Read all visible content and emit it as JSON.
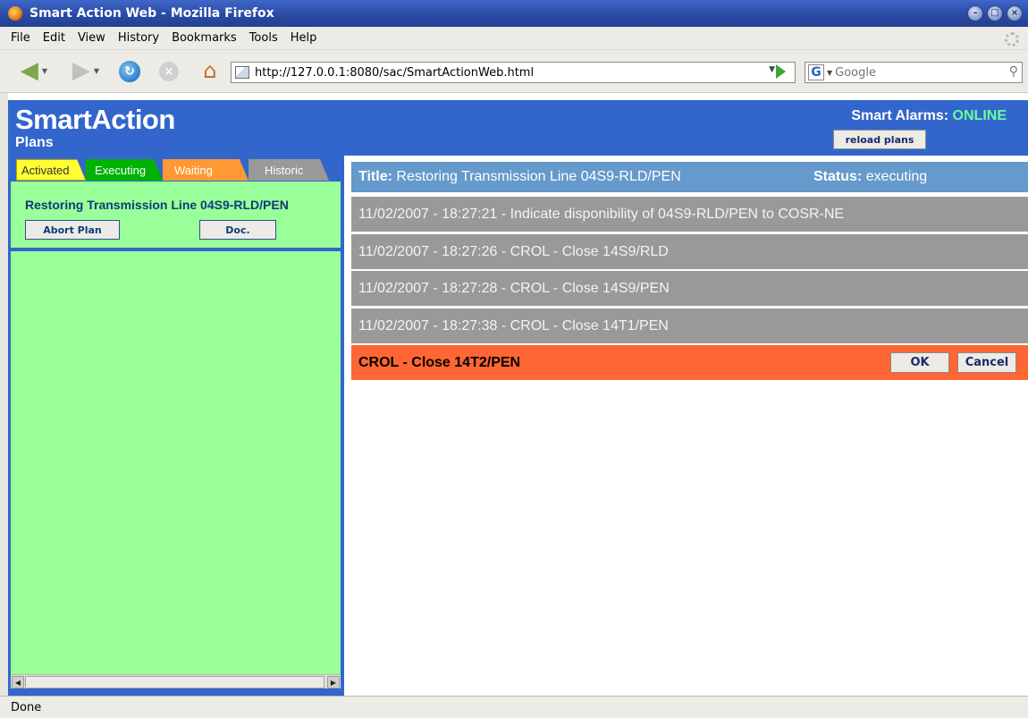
{
  "window": {
    "title": "Smart Action Web - Mozilla Firefox",
    "controls": [
      "minimize",
      "maximize",
      "close"
    ]
  },
  "menubar": {
    "items": [
      "File",
      "Edit",
      "View",
      "History",
      "Bookmarks",
      "Tools",
      "Help"
    ]
  },
  "navbar": {
    "url": "http://127.0.0.1:8080/sac/SmartActionWeb.html",
    "search_placeholder": "Google"
  },
  "app": {
    "brand": "SmartAction",
    "subtitle": "Plans",
    "alarm_label": "Smart Alarms:",
    "alarm_status": "ONLINE",
    "alarm_status_color": "#66ff99",
    "reload_plans_label": "reload plans"
  },
  "tabs": [
    {
      "label": "Activated",
      "color": "#ffff33"
    },
    {
      "label": "Executing",
      "color": "#00b300"
    },
    {
      "label": "Waiting",
      "color": "#ff9933"
    },
    {
      "label": "Historic",
      "color": "#999999"
    }
  ],
  "plans": [
    {
      "title": "Restoring Transmission Line 04S9-RLD/PEN",
      "abort_label": "Abort Plan",
      "doc_label": "Doc."
    }
  ],
  "plan_detail": {
    "title_label": "Title:",
    "title_value": "Restoring Transmission Line 04S9-RLD/PEN",
    "status_label": "Status:",
    "status_value": "executing",
    "steps": [
      "11/02/2007 - 18:27:21 - Indicate disponibility of 04S9-RLD/PEN to COSR-NE",
      "11/02/2007 - 18:27:26 - CROL - Close 14S9/RLD",
      "11/02/2007 - 18:27:28 - CROL - Close 14S9/PEN",
      "11/02/2007 - 18:27:38 - CROL - Close 14T1/PEN"
    ],
    "current_step": {
      "text": "CROL - Close 14T2/PEN",
      "ok_label": "OK",
      "cancel_label": "Cancel"
    }
  },
  "statusbar": {
    "text": "Done"
  },
  "colors": {
    "header_blue": "#3366cc",
    "panel_green": "#99ff99",
    "plan_header": "#6699cc",
    "completed_step": "#999999",
    "current_step": "#ff6633"
  }
}
